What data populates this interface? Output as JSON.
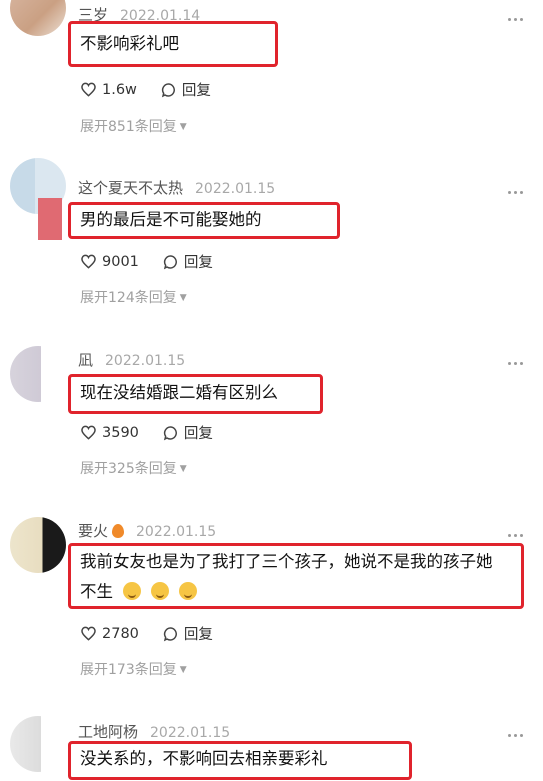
{
  "comments": [
    {
      "username": "三岁",
      "date": "2022.01.14",
      "text": "不影响彩礼吧",
      "likes": "1.6w",
      "reply_label": "回复",
      "expand_label": "展开851条回复"
    },
    {
      "username": "这个夏天不太热",
      "date": "2022.01.15",
      "text": "男的最后是不可能娶她的",
      "likes": "9001",
      "reply_label": "回复",
      "expand_label": "展开124条回复"
    },
    {
      "username": "凪",
      "date": "2022.01.15",
      "text": "现在没结婚跟二婚有区别么",
      "likes": "3590",
      "reply_label": "回复",
      "expand_label": "展开325条回复"
    },
    {
      "username": "要火",
      "date": "2022.01.15",
      "text_line1": "我前女友也是为了我打了三个孩子，她说不是我的孩子她",
      "text_line2": "不生",
      "likes": "2780",
      "reply_label": "回复",
      "expand_label": "展开173条回复"
    },
    {
      "username": "工地阿杨",
      "date": "2022.01.15",
      "text": "没关系的，不影响回去相亲要彩礼"
    }
  ],
  "icons": {
    "like": "heart-outline-icon",
    "reply": "speech-bubble-icon",
    "more": "more-dots-icon",
    "expand": "caret-down-icon"
  },
  "colors": {
    "highlight_border": "#e0232c",
    "meta_text": "#a8a8a8"
  }
}
